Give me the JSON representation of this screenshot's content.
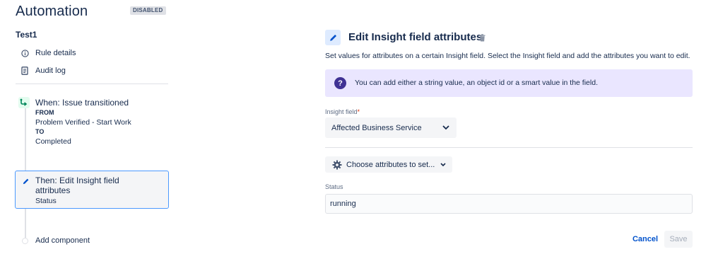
{
  "header": {
    "title": "Automation",
    "status_badge": "DISABLED"
  },
  "rule": {
    "name": "Test1",
    "links": [
      {
        "label": "Rule details",
        "icon": "info-icon"
      },
      {
        "label": "Audit log",
        "icon": "document-icon"
      }
    ]
  },
  "trigger": {
    "title": "When: Issue transitioned",
    "from_key": "FROM",
    "from_value": "Problem Verified - Start Work",
    "to_key": "TO",
    "to_value": "Completed",
    "icon": "transition-icon",
    "icon_color": "#00875a"
  },
  "action": {
    "title": "Then: Edit Insight field attributes",
    "subtitle": "Status",
    "icon": "pencil-icon",
    "selected_border_color": "#4c9aff"
  },
  "add_component": {
    "label": "Add component"
  },
  "editor": {
    "title": "Edit Insight field attributes",
    "description": "Set values for attributes on a certain Insight field. Select the Insight field and add the attributes you want to edit.",
    "info_text": "You can add either a string value, an object id or a smart value in the field.",
    "info_icon_glyph": "?",
    "insight_field_label": "Insight field",
    "required_marker": "*",
    "insight_field_value": "Affected Business Service",
    "choose_attributes_label": "Choose attributes to set...",
    "status_label": "Status",
    "status_value": "running",
    "cancel_label": "Cancel",
    "save_label": "Save"
  },
  "colors": {
    "brand_blue": "#0052cc",
    "info_panel_bg": "#eae6ff",
    "info_icon_bg": "#403294",
    "required_red": "#de350b"
  }
}
